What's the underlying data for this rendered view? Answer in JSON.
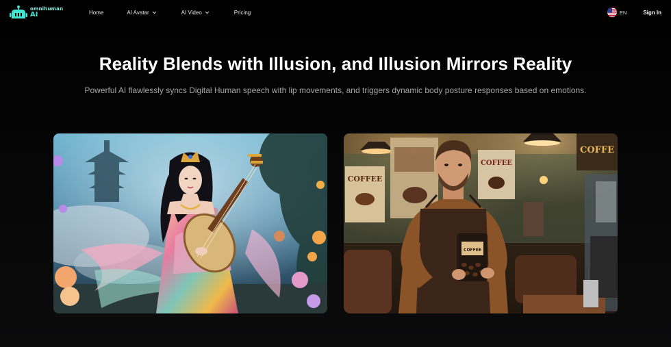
{
  "brand": {
    "logo_top": "omnihuman",
    "logo_bottom": "AI",
    "accent": "#43e5d3"
  },
  "nav": {
    "home": "Home",
    "ai_avatar": "AI Avatar",
    "ai_video": "AI Video",
    "pricing": "Pricing",
    "language": "EN",
    "sign_in": "Sign In",
    "dropdown_icon": "chevron-down-icon",
    "flag_icon": "us-flag-icon"
  },
  "hero": {
    "title": "Reality Blends with Illusion, and Illusion Mirrors Reality",
    "subtitle": "Powerful AI flawlessly syncs Digital Human speech with lip movements, and triggers dynamic body posture responses based on emotions."
  },
  "cards": {
    "left": {
      "subject": "fantasy woman playing pipa"
    },
    "right": {
      "subject": "barista holding coffee bag",
      "poster_text_1": "COFFEE",
      "poster_text_2": "COFFEE",
      "poster_text_3": "COFFE",
      "bag_label": "COFFEE"
    }
  }
}
